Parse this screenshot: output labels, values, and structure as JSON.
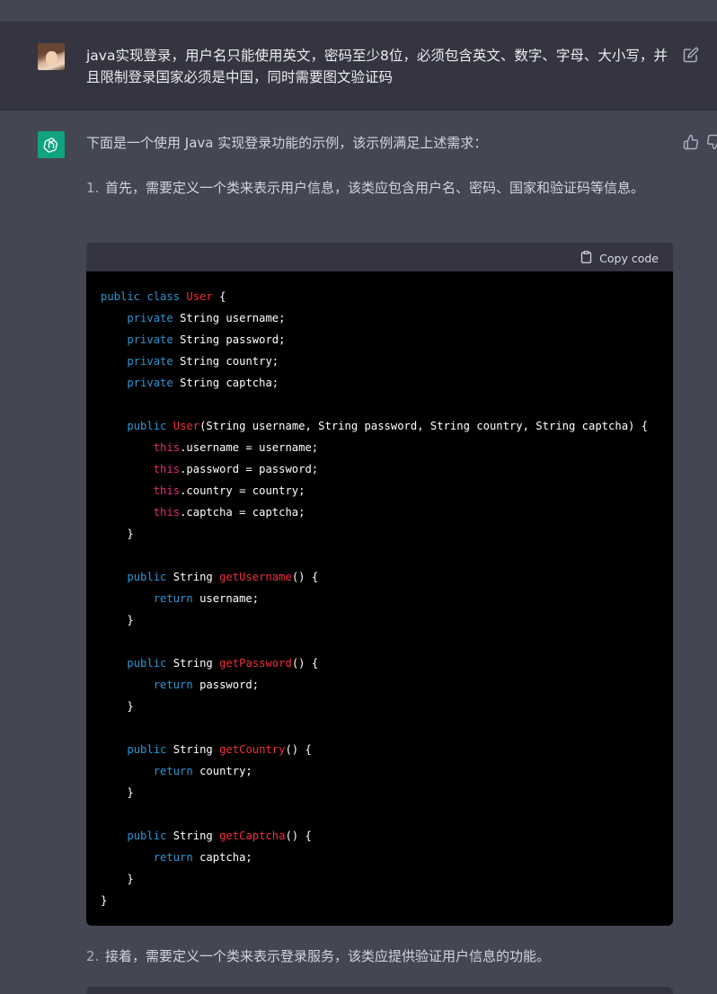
{
  "user_message": {
    "text": "java实现登录，用户名只能使用英文，密码至少8位，必须包含英文、数字、字母、大小写，并且限制登录国家必须是中国，同时需要图文验证码"
  },
  "assistant_message": {
    "intro": "下面是一个使用 Java 实现登录功能的示例，该示例满足上述需求：",
    "steps": [
      {
        "number": "1.",
        "text": "首先，需要定义一个类来表示用户信息，该类应包含用户名、密码、国家和验证码等信息。"
      },
      {
        "number": "2.",
        "text": "接着，需要定义一个类来表示登录服务，该类应提供验证用户信息的功能。"
      }
    ],
    "code_block": {
      "copy_label": "Copy code",
      "code": "public class User {\n    private String username;\n    private String password;\n    private String country;\n    private String captcha;\n\n    public User(String username, String password, String country, String captcha) {\n        this.username = username;\n        this.password = password;\n        this.country = country;\n        this.captcha = captcha;\n    }\n\n    public String getUsername() {\n        return username;\n    }\n\n    public String getPassword() {\n        return password;\n    }\n\n    public String getCountry() {\n        return country;\n    }\n\n    public String getCaptcha() {\n        return captcha;\n    }\n}"
    }
  },
  "icons": {
    "edit": "edit-icon",
    "thumbs_up": "thumbs-up-icon",
    "thumbs_down": "thumbs-down-icon",
    "copy": "clipboard-icon",
    "assistant_logo": "openai-logo-icon"
  },
  "colors": {
    "user_bg": "#343541",
    "assistant_bg": "#444654",
    "code_bg": "#000000",
    "code_header_bg": "#343541",
    "keyword": "#2e95d3",
    "class_name": "#f22c3d",
    "this_keyword": "#df3079",
    "assistant_avatar": "#10a37f"
  }
}
